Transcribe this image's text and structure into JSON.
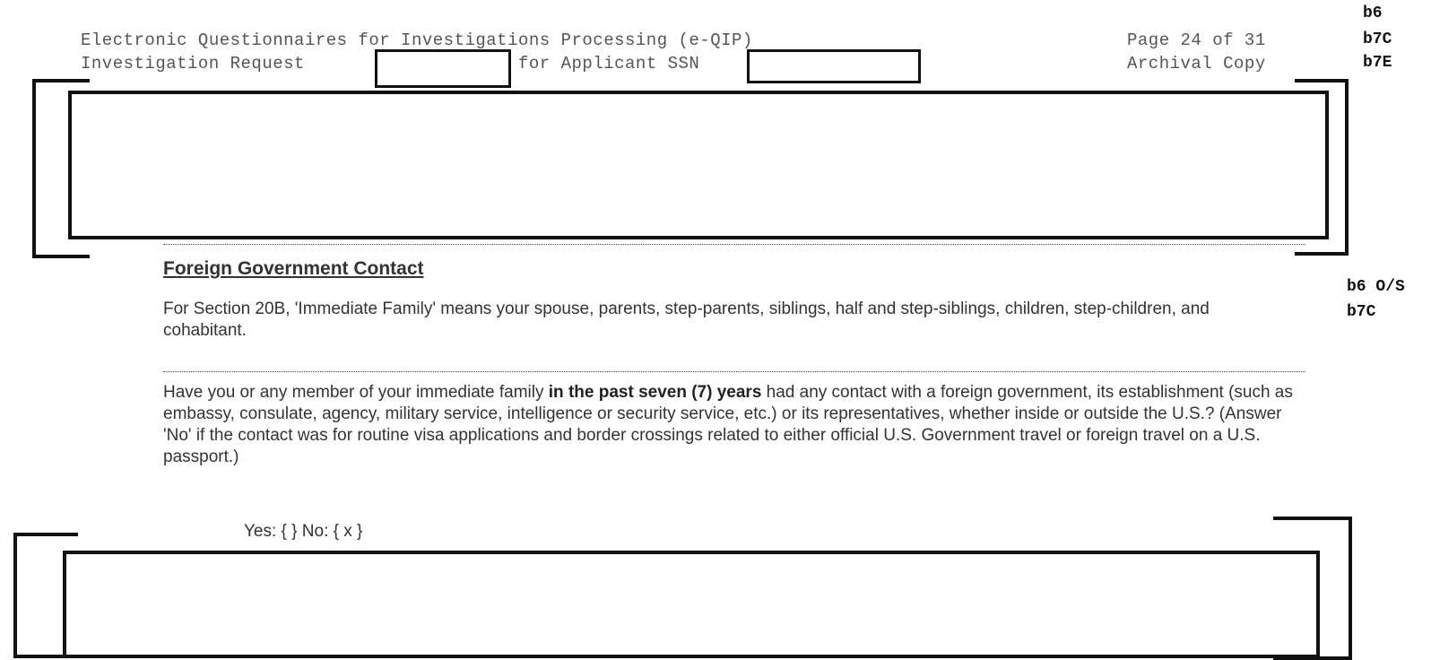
{
  "header": {
    "title": "Electronic Questionnaires for Investigations Processing (e-QIP)",
    "page": "Page 24 of 31",
    "request_label": "Investigation Request",
    "applicant_label": "for Applicant SSN",
    "copy_type": "Archival Copy"
  },
  "exemptions": {
    "top": [
      "b6",
      "b7C",
      "b7E"
    ],
    "middle": [
      "b6 O/S",
      "b7C"
    ]
  },
  "section": {
    "title": "Foreign Government Contact",
    "definition": "For Section 20B, 'Immediate Family' means your spouse, parents, step-parents, siblings, half and step-siblings, children, step-children, and cohabitant.",
    "question_before": "Have you or any member of your immediate family ",
    "question_bold": "in the past seven (7) years",
    "question_after": " had any contact with a foreign government, its establishment (such as embassy, consulate, agency, military service, intelligence or security service, etc.) or its representatives, whether inside or outside the U.S.? (Answer 'No' if the contact was for routine visa applications and border crossings related to either official U.S. Government travel or foreign travel on a U.S. passport.)",
    "answer": "Yes: { } No: { x }"
  }
}
